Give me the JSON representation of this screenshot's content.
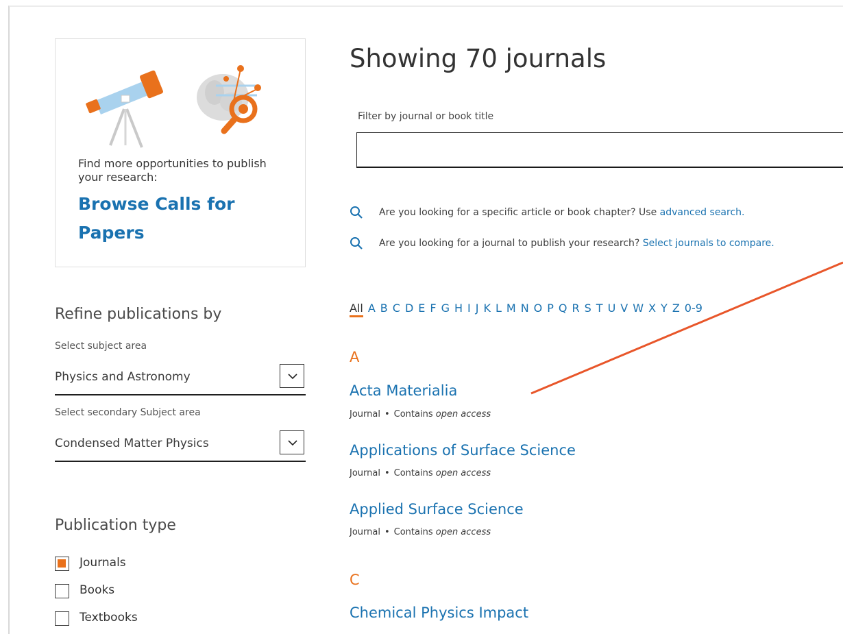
{
  "promo": {
    "text": "Find more opportunities to publish your research:",
    "link": "Browse Calls for Papers"
  },
  "refine": {
    "title": "Refine publications by",
    "subject_label": "Select subject area",
    "subject_value": "Physics and Astronomy",
    "secondary_label": "Select secondary Subject area",
    "secondary_value": "Condensed Matter Physics"
  },
  "publication_type": {
    "title": "Publication type",
    "options": [
      {
        "label": "Journals",
        "checked": true
      },
      {
        "label": "Books",
        "checked": false
      },
      {
        "label": "Textbooks",
        "checked": false
      }
    ]
  },
  "main": {
    "title": "Showing 70 journals",
    "filter_label": "Filter by journal or book title",
    "filter_value": "",
    "hints": [
      {
        "text": "Are you looking for a specific article or book chapter? Use ",
        "link": "advanced search."
      },
      {
        "text": "Are you looking for a journal to publish your research? ",
        "link": "Select journals to compare."
      }
    ]
  },
  "alphabet": [
    "All",
    "A",
    "B",
    "C",
    "D",
    "E",
    "F",
    "G",
    "H",
    "I",
    "J",
    "K",
    "L",
    "M",
    "N",
    "O",
    "P",
    "Q",
    "R",
    "S",
    "T",
    "U",
    "V",
    "W",
    "X",
    "Y",
    "Z",
    "0-9"
  ],
  "alphabet_active": "All",
  "groups": [
    {
      "letter": "A",
      "journals": [
        {
          "title": "Acta Materialia",
          "type": "Journal",
          "access_prefix": "Contains ",
          "access": "open access"
        },
        {
          "title": "Applications of Surface Science",
          "type": "Journal",
          "access_prefix": "Contains ",
          "access": "open access"
        },
        {
          "title": "Applied Surface Science",
          "type": "Journal",
          "access_prefix": "Contains ",
          "access": "open access"
        }
      ]
    },
    {
      "letter": "C",
      "journals": [
        {
          "title": "Chemical Physics Impact"
        }
      ]
    }
  ],
  "colors": {
    "accent": "#e9711c",
    "link": "#1a72b0",
    "annotation": "#e8562a"
  },
  "icons": {
    "search": "magnifier-icon",
    "dropdown": "chevron-down-icon"
  }
}
